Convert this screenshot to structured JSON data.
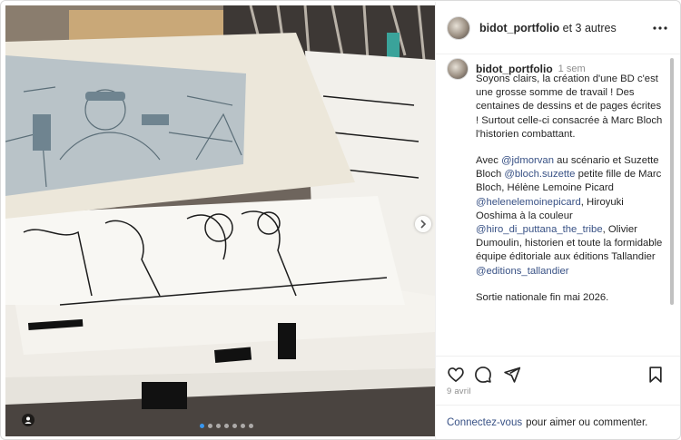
{
  "post": {
    "header": {
      "username": "bidot_portfolio",
      "coauthors": "et 3 autres"
    },
    "caption": {
      "username": "bidot_portfolio",
      "time": "1 sem",
      "paragraph1": "Soyons clairs, la création d'une BD c'est une grosse somme de travail ! Des centaines de dessins et de pages écrites ! Surtout celle-ci consacrée à Marc Bloch l'historien combattant.",
      "p2_t1": "Avec ",
      "p2_m1": "@jdmorvan",
      "p2_t2": " au scénario et Suzette Bloch ",
      "p2_m2": "@bloch.suzette",
      "p2_t3": " petite fille de Marc Bloch, Hélène Lemoine Picard ",
      "p2_m3": "@helenelemoinepicard",
      "p2_t4": ", Hiroyuki Ooshima à la couleur ",
      "p2_m4": "@hiro_di_puttana_the_tribe",
      "p2_t5": ", Olivier Dumoulin, historien et toute la formidable équipe éditoriale aux éditions Tallandier ",
      "p2_m5": "@editions_tallandier",
      "paragraph3": "Sortie nationale fin mai 2026."
    },
    "date": "9 avril",
    "footer": {
      "login_link": "Connectez-vous",
      "login_text": "pour aimer ou commenter."
    },
    "carousel": {
      "slide_count": 7,
      "active_index": 0
    }
  },
  "icons": {
    "more": "more-horizontal-icon",
    "like": "heart-icon",
    "comment": "comment-icon",
    "share": "send-icon",
    "save": "bookmark-icon",
    "next": "chevron-right-icon",
    "tag": "user-tag-icon",
    "load_more": "plus-circle-icon"
  },
  "colors": {
    "link": "#385185",
    "muted": "#8e8e8e",
    "carousel_active": "#3897f0"
  }
}
